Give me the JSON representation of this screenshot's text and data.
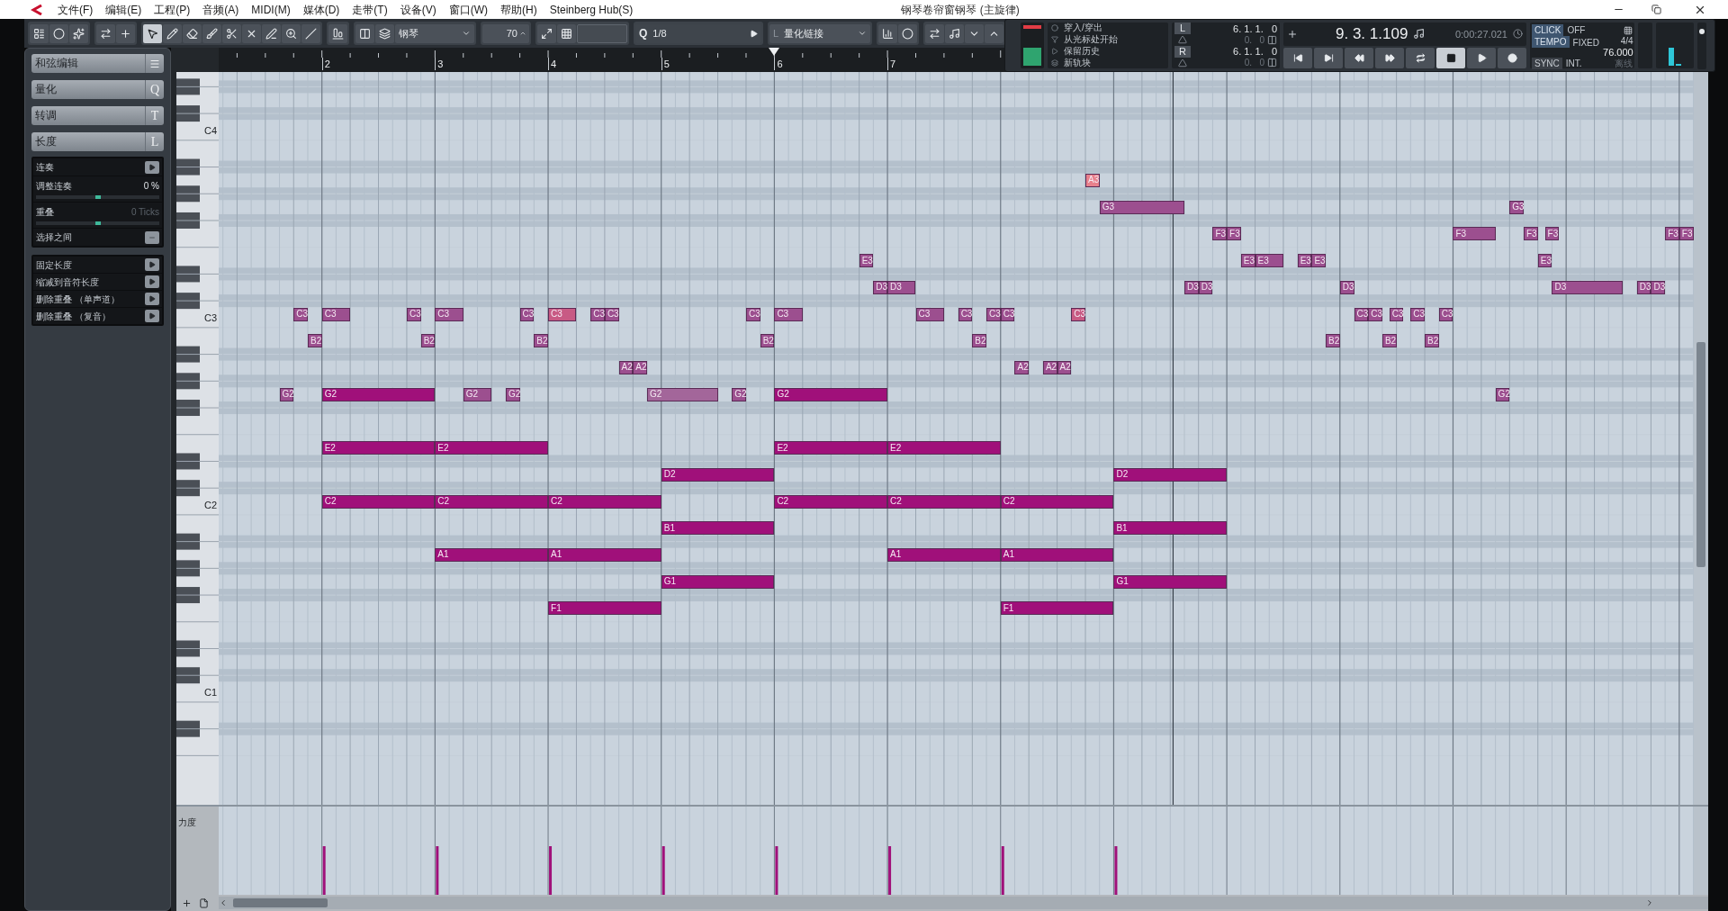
{
  "title_bar": {
    "menu": [
      "文件(F)",
      "编辑(E)",
      "工程(P)",
      "音频(A)",
      "MIDI(M)",
      "媒体(D)",
      "走带(T)",
      "设备(V)",
      "窗口(W)",
      "帮助(H)",
      "Steinberg Hub(S)"
    ],
    "title": "钢琴卷帘窗钢琴 (主旋律)"
  },
  "toolbar": {
    "instrument": "钢琴",
    "velocity": "70",
    "quantize_icon": "Q",
    "quantize": "1/8",
    "quantize_link_icon": "L",
    "quantize_link": "量化链接"
  },
  "transport": {
    "options": [
      "穿入/穿出",
      "从光标处开始",
      "保留历史",
      "新轨块"
    ],
    "locators": [
      {
        "label": "L",
        "position": "6. 1. 1.   0",
        "offset": "0.   0"
      },
      {
        "label": "R",
        "position": "6. 1. 1.   0",
        "offset": "0.   0"
      }
    ],
    "position": "9. 3. 1.109",
    "time": "0:00:27.021",
    "click": {
      "label": "CLICK",
      "value": "OFF"
    },
    "tempo": {
      "label": "TEMPO",
      "value": "FIXED",
      "signature": "4/4",
      "bpm": "76.000"
    },
    "sync": {
      "label": "SYNC",
      "value": "INT.",
      "status": "离线"
    },
    "volume": {
      "level": 0.85
    }
  },
  "inspector": {
    "sections": [
      {
        "label": "和弦编辑"
      },
      {
        "label": "量化",
        "key": "Q"
      },
      {
        "label": "转调",
        "key": "T"
      },
      {
        "label": "长度",
        "key": "L"
      }
    ],
    "length_tools": [
      {
        "kind": "action",
        "label": "连奏"
      },
      {
        "kind": "slider",
        "label": "调整连奏",
        "value": "0 %",
        "level": 0.5,
        "disabled": false
      },
      {
        "kind": "slider",
        "label": "重叠",
        "value": "0 Ticks",
        "level": 0.5,
        "disabled": true
      },
      {
        "kind": "menu",
        "label": "选择之间"
      }
    ],
    "functions": [
      "固定长度",
      "缩减到音符长度",
      "删除重叠 （单声道）",
      "删除重叠 （复音）"
    ]
  },
  "ruler": [
    "2",
    "3",
    "4",
    "5",
    "6",
    "7"
  ],
  "keyboard": [
    "C4",
    "C3",
    "C2",
    "C1"
  ],
  "notes": [
    {
      "label": "A3",
      "color": "#e8808c"
    },
    {
      "label": "G3",
      "color": "#9c4f8f"
    },
    {
      "label": "G3",
      "color": "#9c4f8f"
    },
    {
      "label": "F3",
      "color": "#9c4f8f"
    },
    {
      "label": "F3",
      "color": "#9c4f8f"
    },
    {
      "label": "F3",
      "color": "#9c4f8f"
    },
    {
      "label": "F3",
      "color": "#9c4f8f"
    },
    {
      "label": "F3",
      "color": "#9c4f8f"
    },
    {
      "label": "F3",
      "color": "#9c4f8f"
    },
    {
      "label": "F3",
      "color": "#9c4f8f"
    },
    {
      "label": "E3",
      "color": "#9c4f8f"
    },
    {
      "label": "E3",
      "color": "#9c4f8f"
    },
    {
      "label": "E3",
      "color": "#9c4f8f"
    },
    {
      "label": "E3",
      "color": "#9c4f8f"
    },
    {
      "label": "E3",
      "color": "#9c4f8f"
    },
    {
      "label": "E3",
      "color": "#9c4f8f"
    },
    {
      "label": "D3",
      "color": "#9c4f8f"
    },
    {
      "label": "D3",
      "color": "#9c4f8f"
    },
    {
      "label": "D3",
      "color": "#9c4f8f"
    },
    {
      "label": "D3",
      "color": "#9c4f8f"
    },
    {
      "label": "D3",
      "color": "#9c4f8f"
    },
    {
      "label": "D3",
      "color": "#9c4f8f"
    },
    {
      "label": "D3",
      "color": "#9c4f8f"
    },
    {
      "label": "D3",
      "color": "#9c4f8f"
    },
    {
      "label": "C3",
      "color": "#9c4f8f"
    },
    {
      "label": "C3",
      "color": "#9c4f8f"
    },
    {
      "label": "C3",
      "color": "#9c4f8f"
    },
    {
      "label": "C3",
      "color": "#9c4f8f"
    },
    {
      "label": "C3",
      "color": "#9c4f8f"
    },
    {
      "label": "C3",
      "color": "#c85a84"
    },
    {
      "label": "C3",
      "color": "#9c4f8f"
    },
    {
      "label": "C3",
      "color": "#9c4f8f"
    },
    {
      "label": "C3",
      "color": "#9c4f8f"
    },
    {
      "label": "C3",
      "color": "#9c4f8f"
    },
    {
      "label": "C3",
      "color": "#9c4f8f"
    },
    {
      "label": "C3",
      "color": "#9c4f8f"
    },
    {
      "label": "C3",
      "color": "#9c4f8f"
    },
    {
      "label": "C3",
      "color": "#9c4f8f"
    },
    {
      "label": "C3",
      "color": "#c85a84"
    },
    {
      "label": "C3",
      "color": "#9c4f8f"
    },
    {
      "label": "C3",
      "color": "#9c4f8f"
    },
    {
      "label": "C3",
      "color": "#9c4f8f"
    },
    {
      "label": "C3",
      "color": "#9c4f8f"
    },
    {
      "label": "C3",
      "color": "#9c4f8f"
    },
    {
      "label": "B2",
      "color": "#9c4f8f"
    },
    {
      "label": "B2",
      "color": "#9c4f8f"
    },
    {
      "label": "B2",
      "color": "#9c4f8f"
    },
    {
      "label": "B2",
      "color": "#9c4f8f"
    },
    {
      "label": "B2",
      "color": "#9c4f8f"
    },
    {
      "label": "B2",
      "color": "#9c4f8f"
    },
    {
      "label": "B2",
      "color": "#9c4f8f"
    },
    {
      "label": "B2",
      "color": "#9c4f8f"
    },
    {
      "label": "A2",
      "color": "#9c4f8f"
    },
    {
      "label": "A2",
      "color": "#9c4f8f"
    },
    {
      "label": "A2",
      "color": "#9c4f8f"
    },
    {
      "label": "A2",
      "color": "#9c4f8f"
    },
    {
      "label": "A2",
      "color": "#9c4f8f"
    },
    {
      "label": "G2",
      "color": "#9c4f8f"
    },
    {
      "label": "G2",
      "color": "#a0107a"
    },
    {
      "label": "G2",
      "color": "#9c4f8f"
    },
    {
      "label": "G2",
      "color": "#9c4f8f"
    },
    {
      "label": "G2",
      "color": "#a3669a"
    },
    {
      "label": "G2",
      "color": "#9c4f8f"
    },
    {
      "label": "G2",
      "color": "#a0107a"
    },
    {
      "label": "G2",
      "color": "#9c4f8f"
    },
    {
      "label": "E2",
      "color": "#a0107a"
    },
    {
      "label": "E2",
      "color": "#a0107a"
    },
    {
      "label": "E2",
      "color": "#a0107a"
    },
    {
      "label": "E2",
      "color": "#a0107a"
    },
    {
      "label": "D2",
      "color": "#a0107a"
    },
    {
      "label": "D2",
      "color": "#a0107a"
    },
    {
      "label": "C2",
      "color": "#a0107a"
    },
    {
      "label": "C2",
      "color": "#a0107a"
    },
    {
      "label": "C2",
      "color": "#a0107a"
    },
    {
      "label": "C2",
      "color": "#a0107a"
    },
    {
      "label": "C2",
      "color": "#a0107a"
    },
    {
      "label": "C2",
      "color": "#a0107a"
    },
    {
      "label": "B1",
      "color": "#a0107a"
    },
    {
      "label": "B1",
      "color": "#a0107a"
    },
    {
      "label": "A1",
      "color": "#a0107a"
    },
    {
      "label": "A1",
      "color": "#a0107a"
    },
    {
      "label": "A1",
      "color": "#a0107a"
    },
    {
      "label": "A1",
      "color": "#a0107a"
    },
    {
      "label": "G1",
      "color": "#a0107a"
    },
    {
      "label": "G1",
      "color": "#a0107a"
    },
    {
      "label": "F1",
      "color": "#a0107a"
    },
    {
      "label": "F1",
      "color": "#a0107a"
    }
  ],
  "velocity_lane": {
    "label": "力度"
  }
}
